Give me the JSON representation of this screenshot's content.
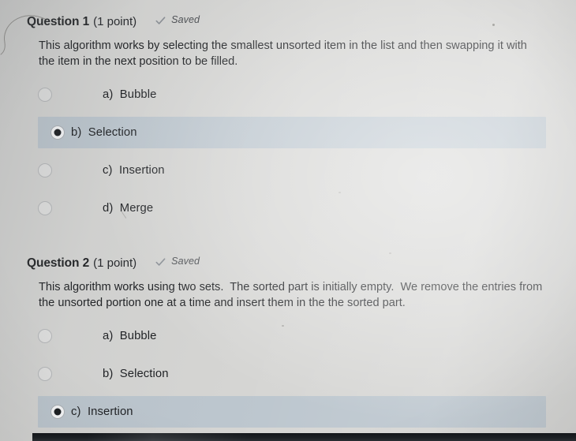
{
  "page": {
    "background_color": "#d5d5d3",
    "highlight_color": "#bcc6ce",
    "text_color": "#1b1d20"
  },
  "questions": [
    {
      "title": "Question 1",
      "points": "(1 point)",
      "status": "Saved",
      "status_icon": "check-icon",
      "prompt": "This algorithm works by selecting the smallest unsorted item in the list and then swapping it with the item in the next position to be filled.",
      "options": [
        {
          "label": "a)  Bubble",
          "selected": false
        },
        {
          "label": "b)  Selection",
          "selected": true
        },
        {
          "label": "c)  Insertion",
          "selected": false
        },
        {
          "label": "d)  Merge",
          "selected": false
        }
      ]
    },
    {
      "title": "Question 2",
      "points": "(1 point)",
      "status": "Saved",
      "status_icon": "check-icon",
      "prompt": "This algorithm works using two sets.  The sorted part is initially empty.  We remove the entries from the unsorted portion one at a time and insert them in the the sorted part.",
      "options": [
        {
          "label": "a)  Bubble",
          "selected": false
        },
        {
          "label": "b)  Selection",
          "selected": false
        },
        {
          "label": "c)  Insertion",
          "selected": true
        }
      ]
    }
  ]
}
